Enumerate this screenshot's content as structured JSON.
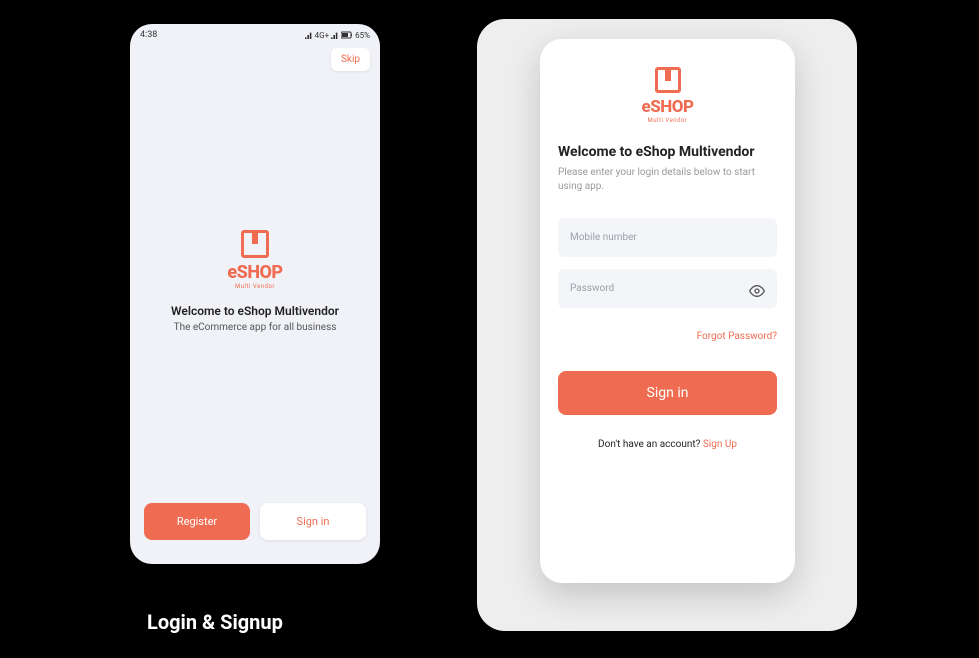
{
  "status": {
    "time": "4:38",
    "net": "4G+",
    "battery": "65%"
  },
  "brand": {
    "name_lower": "e",
    "name_upper": "SHOP",
    "tagline": "Multi Vendor"
  },
  "welcome": {
    "skip": "Skip",
    "title": "Welcome to eShop Multivendor",
    "subtitle": "The eCommerce app for all business",
    "register_btn": "Register",
    "signin_btn": "Sign in"
  },
  "login": {
    "title": "Welcome to eShop Multivendor",
    "subtitle": "Please enter your login details below to start using app.",
    "mobile_placeholder": "Mobile number",
    "password_placeholder": "Password",
    "forgot": "Forgot Password?",
    "signin_btn": "Sign in",
    "no_account": "Don't have an account? ",
    "signup": "Sign Up"
  },
  "caption": "Login & Signup"
}
